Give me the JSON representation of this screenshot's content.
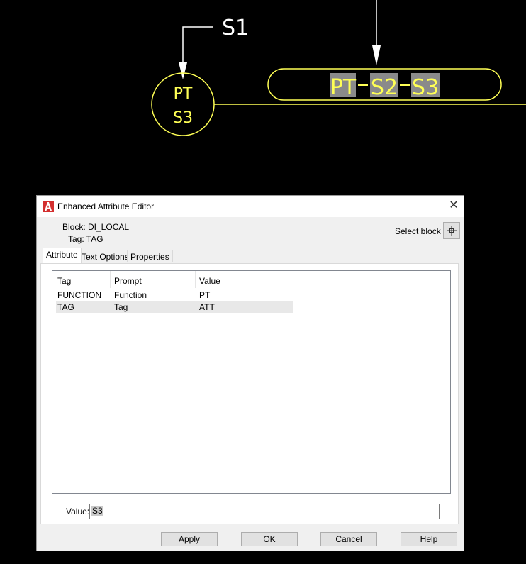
{
  "drawing": {
    "leader_label": "S1",
    "bubble_top": "PT",
    "bubble_bottom": "S3",
    "tag_parts": [
      "PT",
      "S2",
      "S3"
    ],
    "color": "#ffff55"
  },
  "dialog": {
    "title": "Enhanced Attribute Editor",
    "block_line": "Block: DI_LOCAL",
    "tag_line": "Tag: TAG",
    "select_block_label": "Select block",
    "tabs": [
      "Attribute",
      "Text Options",
      "Properties"
    ],
    "active_tab": "Attribute",
    "columns": [
      "Tag",
      "Prompt",
      "Value"
    ],
    "rows": [
      {
        "tag": "FUNCTION",
        "prompt": "Function",
        "value": "PT"
      },
      {
        "tag": "TAG",
        "prompt": "Tag",
        "value": "ATT"
      }
    ],
    "value_label": "Value:",
    "value_text": "S3",
    "buttons": {
      "apply": "Apply",
      "ok": "OK",
      "cancel": "Cancel",
      "help": "Help"
    }
  }
}
